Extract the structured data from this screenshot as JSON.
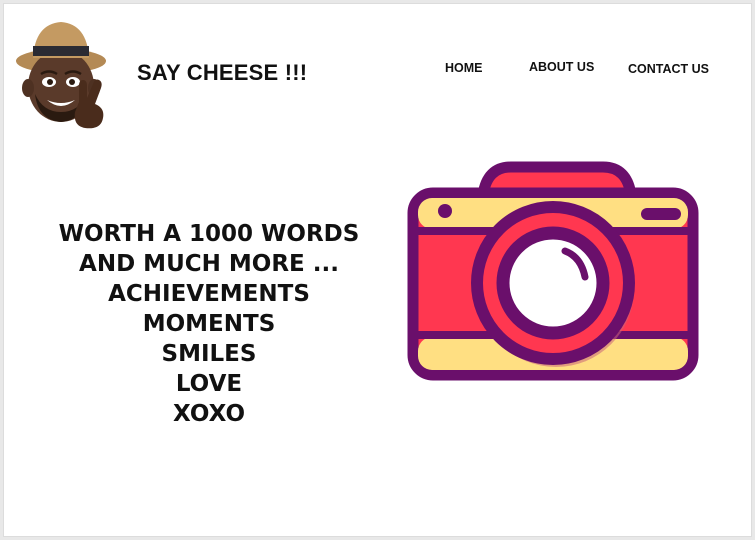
{
  "header": {
    "logo_icon": "memoji-peace-sign-icon",
    "brand": "SAY CHEESE !!!"
  },
  "nav": {
    "home": "HOME",
    "about": "ABOUT US",
    "contact": "CONTACT US"
  },
  "hero": {
    "lines": [
      "WORTH A 1000 WORDS",
      "AND MUCH MORE ...",
      "ACHIEVEMENTS",
      "MOMENTS",
      "SMILES",
      "LOVE",
      "XOXO"
    ],
    "illustration_icon": "camera-icon"
  },
  "colors": {
    "camera_outline": "#6a0f6b",
    "camera_body": "#ff3750",
    "camera_trim": "#ffdf82",
    "text": "#111111"
  }
}
